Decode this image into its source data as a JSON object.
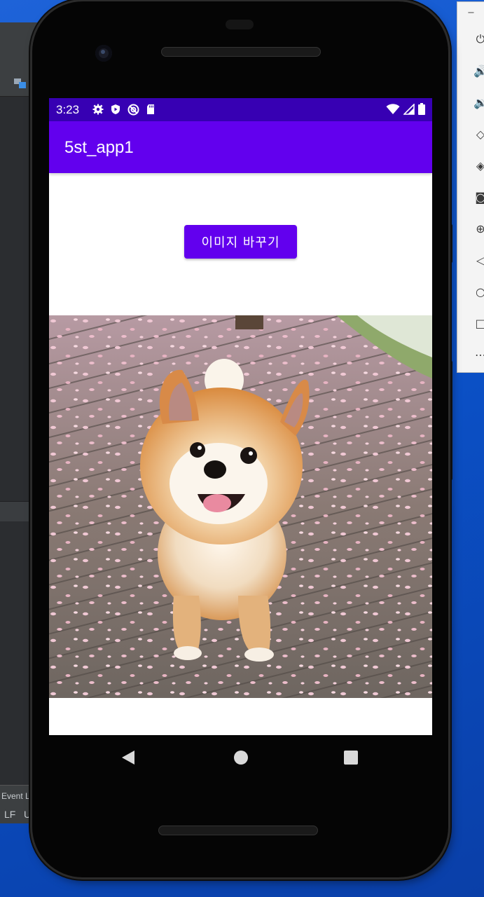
{
  "ide": {
    "status_event_label": "Event L",
    "status_lf": "LF",
    "status_u": "U"
  },
  "emulator_panel": {
    "minimize_label": "−",
    "tools": [
      "power-icon",
      "volume-up-icon",
      "volume-down-icon",
      "rotate-left-icon",
      "rotate-right-icon",
      "camera-icon",
      "zoom-icon",
      "back-icon",
      "home-icon",
      "overview-icon",
      "more-icon"
    ]
  },
  "statusbar": {
    "time": "3:23",
    "icons": [
      "settings-icon",
      "shield-icon",
      "at-icon",
      "sdcard-icon"
    ],
    "right_icons": [
      "wifi-icon",
      "signal-icon",
      "battery-icon"
    ]
  },
  "appbar": {
    "title": "5st_app1"
  },
  "main": {
    "change_image_button": "이미지 바꾸기",
    "image_subject": "pomeranian-dog-photo"
  },
  "navbar": {
    "buttons": [
      "back-button",
      "home-button",
      "recents-button"
    ]
  },
  "colors": {
    "status_bar": "#3700b3",
    "app_bar": "#6200ee",
    "button": "#6200ee"
  }
}
